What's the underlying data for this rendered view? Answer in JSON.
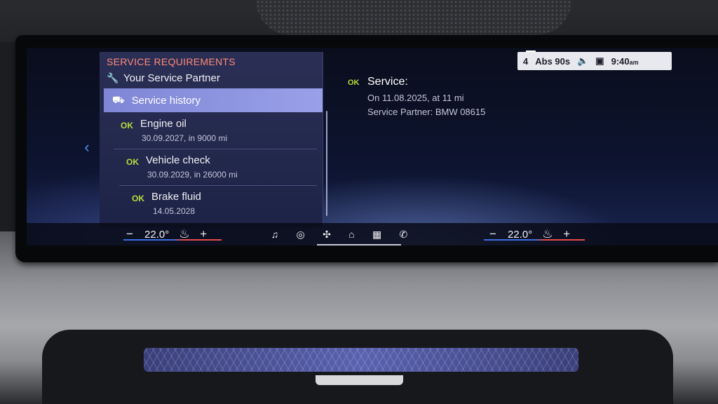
{
  "service_panel": {
    "title": "SERVICE REQUIREMENTS",
    "subtitle": "Your Service Partner",
    "history_label": "Service history",
    "items": [
      {
        "status": "OK",
        "name": "Engine oil",
        "detail": "30.09.2027, in 9000 mi"
      },
      {
        "status": "OK",
        "name": "Vehicle check",
        "detail": "30.09.2029, in 26000 mi"
      },
      {
        "status": "OK",
        "name": "Brake fluid",
        "detail": "14.05.2028"
      }
    ]
  },
  "detail": {
    "status": "OK",
    "title": "Service:",
    "line1": "On 11.08.2025, at 11 mi",
    "line2": "Service Partner: BMW 08615"
  },
  "status_bar": {
    "signal": "4",
    "abs_label": "Abs 90s",
    "time": "9:40",
    "ampm": "am"
  },
  "climate": {
    "left_minus": "−",
    "left_temp": "22.0°",
    "left_plus": "+",
    "right_minus": "−",
    "right_temp": "22.0°",
    "right_plus": "+"
  },
  "icons": {
    "back": "chevron-left-icon",
    "wrench": "wrench-icon",
    "history": "car-history-icon",
    "music": "music-icon",
    "nav": "navigation-icon",
    "fan": "fan-icon",
    "home": "home-icon",
    "apps": "apps-grid-icon",
    "phone": "phone-icon",
    "seat": "seat-heat-icon"
  },
  "colors": {
    "ok_green": "#b7dc3c",
    "title_red": "#ff8a7a",
    "highlight": "#8f95e0"
  }
}
